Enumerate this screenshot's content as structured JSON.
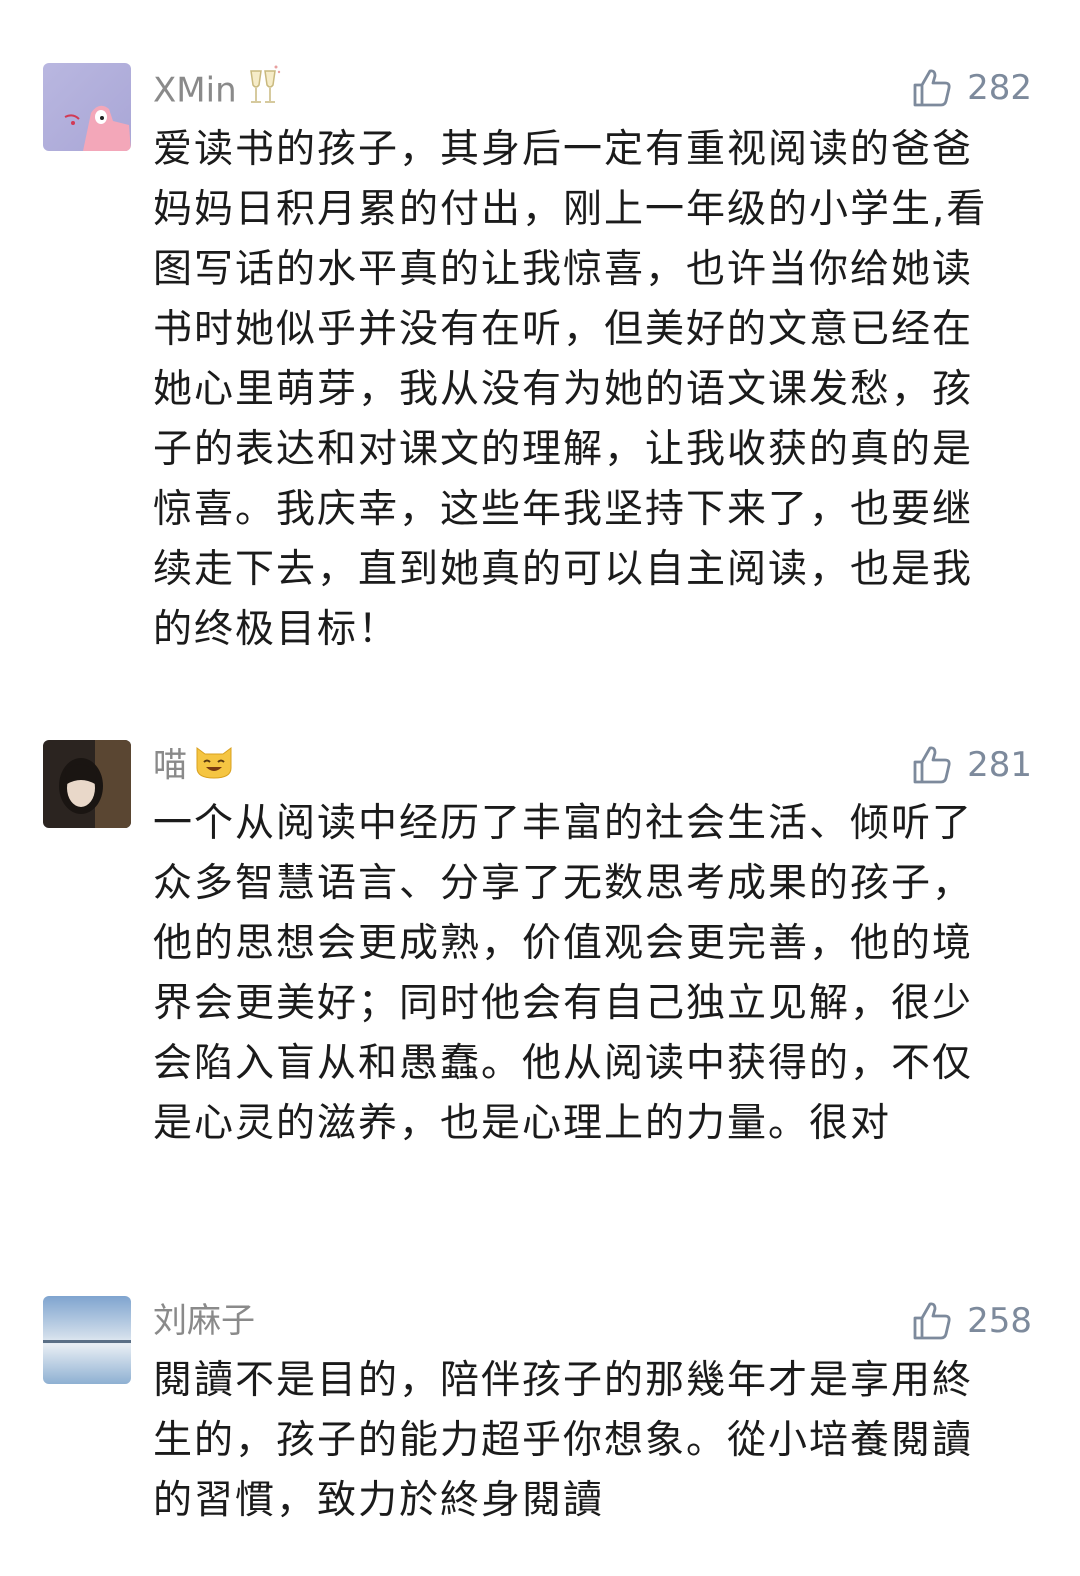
{
  "comments": [
    {
      "username": "XMin",
      "likes": "282",
      "text": "爱读书的孩子，其身后一定有重视阅读的爸爸妈妈日积月累的付出，刚上一年级的小学生,看图写话的水平真的让我惊喜，也许当你给她读书时她似乎并没有在听，但美好的文意已经在她心里萌芽，我从没有为她的语文课发愁，孩子的表达和对课文的理解，让我收获的真的是惊喜。我庆幸，这些年我坚持下来了，也要继续走下去，直到她真的可以自主阅读，也是我的终极目标！"
    },
    {
      "username": "喵",
      "likes": "281",
      "text": "一个从阅读中经历了丰富的社会生活、倾听了众多智慧语言、分享了无数思考成果的孩子，他的思想会更成熟，价值观会更完善，他的境界会更美好；同时他会有自己独立见解，很少会陷入盲从和愚蠢。他从阅读中获得的，不仅是心灵的滋养，也是心理上的力量。很对"
    },
    {
      "username": "刘麻子",
      "likes": "258",
      "text": "閱讀不是目的，陪伴孩子的那幾年才是享用終生的，孩子的能力超乎你想象。從小培養閱讀的習慣，致力於終身閱讀"
    }
  ],
  "icons": {
    "like": "thumbs-up-icon",
    "champagne": "champagne-emoji-icon",
    "cat": "cat-emoji-icon"
  },
  "colors": {
    "username": "#8a8a8a",
    "likes": "#7d8a9c",
    "text": "#1b1b1b"
  }
}
